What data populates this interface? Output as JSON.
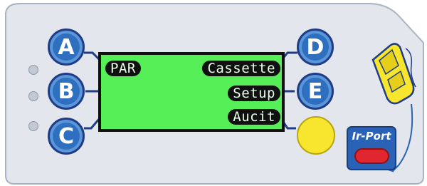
{
  "buttons": {
    "a": "A",
    "b": "B",
    "c": "C",
    "d": "D",
    "e": "E"
  },
  "lcd": {
    "top_left": "PAR",
    "top_right": "Cassette",
    "middle_right": "Setup",
    "bottom_right": "Aucit"
  },
  "ir_port": {
    "label": "Ir-Port"
  },
  "colors": {
    "panel": "#e3e6ed",
    "lcd_background": "#57ef57",
    "button_blue": "#2f6fc0",
    "yellow_button": "#f7e62d",
    "red_button": "#e0262e"
  },
  "icons": [
    "handheld-remote-icon",
    "curved-arrow-icon"
  ]
}
